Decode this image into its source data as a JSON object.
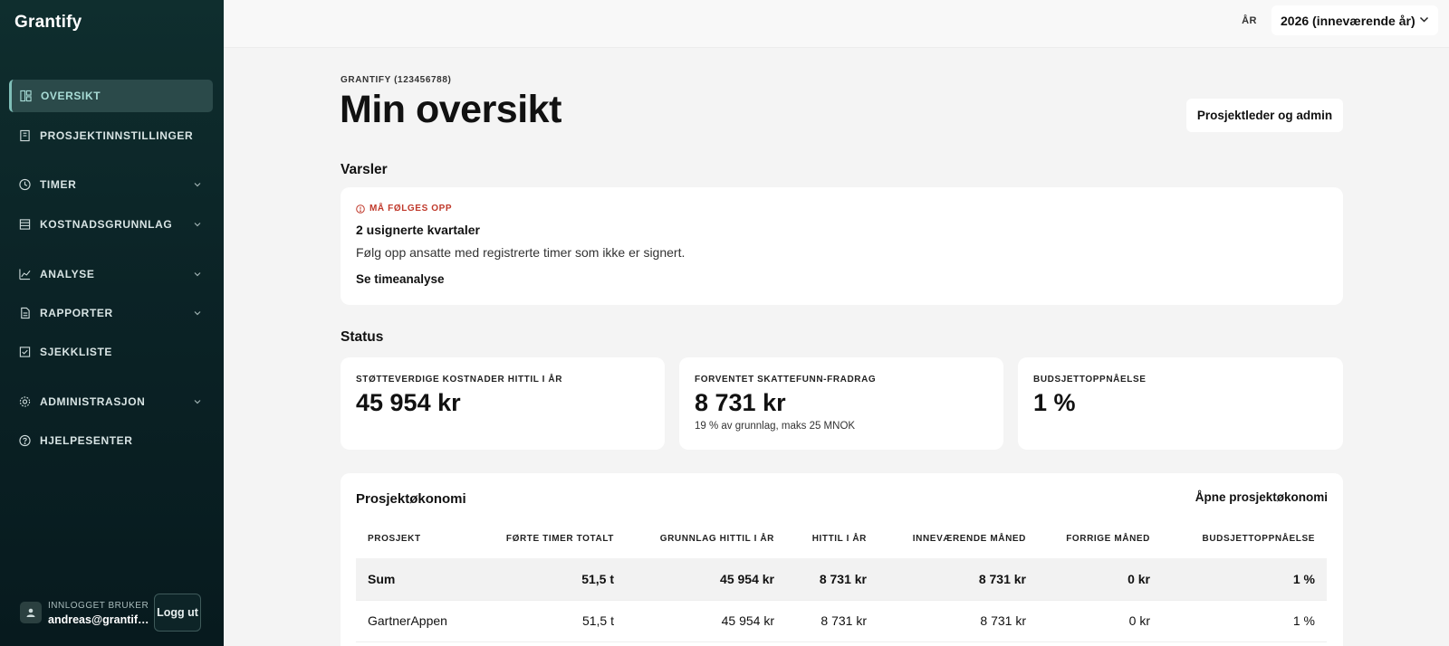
{
  "app": {
    "brand": "Grantify"
  },
  "sidebar": {
    "items": [
      {
        "label": "OVERSIKT",
        "icon": "dashboard-icon"
      },
      {
        "label": "PROSJEKTINNSTILLINGER",
        "icon": "project-settings-icon"
      },
      {
        "label": "TIMER",
        "icon": "clock-icon"
      },
      {
        "label": "KOSTNADSGRUNNLAG",
        "icon": "table-icon"
      },
      {
        "label": "ANALYSE",
        "icon": "chart-line-icon"
      },
      {
        "label": "RAPPORTER",
        "icon": "report-icon"
      },
      {
        "label": "SJEKKLISTE",
        "icon": "checklist-icon"
      },
      {
        "label": "ADMINISTRASJON",
        "icon": "gear-icon"
      },
      {
        "label": "HJELPESENTER",
        "icon": "help-icon"
      }
    ],
    "user": {
      "caption": "INNLOGGET BRUKER",
      "email": "andreas@grantif…",
      "logout": "Logg ut"
    }
  },
  "topbar": {
    "year_label": "ÅR",
    "year_value": "2026 (inneværende år)"
  },
  "page": {
    "org": "GRANTIFY (123456788)",
    "title": "Min oversikt",
    "admin_button": "Prosjektleder og admin"
  },
  "alerts": {
    "heading": "Varsler",
    "tag": "MÅ FØLGES OPP",
    "title": "2 usignerte kvartaler",
    "text": "Følg opp ansatte med registrerte timer som ikke er signert.",
    "link": "Se timeanalyse"
  },
  "status": {
    "heading": "Status",
    "cards": [
      {
        "label": "STØTTEVERDIGE KOSTNADER HITTIL I ÅR",
        "value": "45 954 kr",
        "sub": ""
      },
      {
        "label": "FORVENTET SKATTEFUNN-FRADRAG",
        "value": "8 731 kr",
        "sub": "19 % av grunnlag, maks 25 MNOK"
      },
      {
        "label": "BUDSJETTOPPNÅELSE",
        "value": "1 %",
        "sub": ""
      }
    ]
  },
  "economy": {
    "title": "Prosjektøkonomi",
    "link": "Åpne prosjektøkonomi",
    "columns": [
      "PROSJEKT",
      "FØRTE TIMER TOTALT",
      "GRUNNLAG HITTIL I ÅR",
      "HITTIL I ÅR",
      "INNEVÆRENDE MÅNED",
      "FORRIGE MÅNED",
      "BUDSJETTOPPNÅELSE"
    ],
    "rows": [
      [
        "Sum",
        "51,5 t",
        "45 954 kr",
        "8 731 kr",
        "8 731 kr",
        "0 kr",
        "1 %"
      ],
      [
        "GartnerAppen",
        "51,5 t",
        "45 954 kr",
        "8 731 kr",
        "8 731 kr",
        "0 kr",
        "1 %"
      ]
    ]
  },
  "colors": {
    "sidebar": "#0b2326",
    "active": "#2b4a4a",
    "accent": "#a8dcd6",
    "alert": "#c0392b"
  }
}
